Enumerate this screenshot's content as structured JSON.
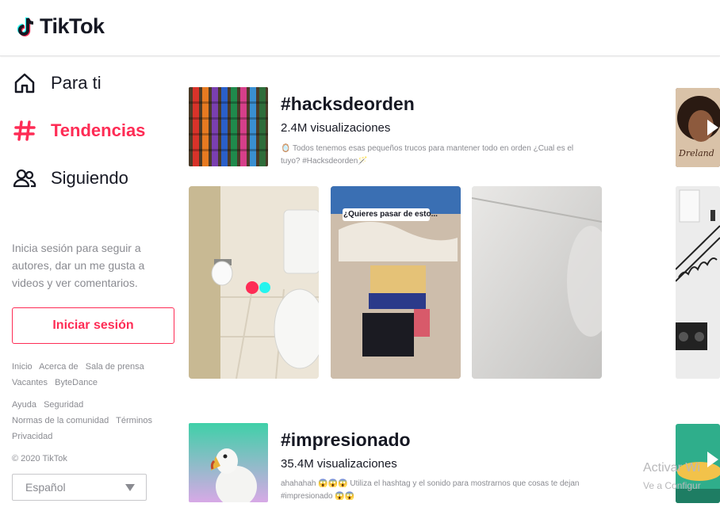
{
  "brand": {
    "name": "TikTok"
  },
  "nav": [
    {
      "label": "Para ti",
      "icon": "home-icon"
    },
    {
      "label": "Tendencias",
      "icon": "hashtag-icon",
      "active": true
    },
    {
      "label": "Siguiendo",
      "icon": "users-icon"
    }
  ],
  "sidebar": {
    "hint": "Inicia sesión para seguir a autores, dar un me gusta a videos y ver comentarios.",
    "login_label": "Iniciar sesión",
    "footer_row1": [
      "Inicio",
      "Acerca de",
      "Sala de prensa"
    ],
    "footer_row2": [
      "Vacantes",
      "ByteDance"
    ],
    "footer_row3": [
      "Ayuda",
      "Seguridad"
    ],
    "footer_row4": [
      "Normas de la comunidad",
      "Términos"
    ],
    "footer_row5": [
      "Privacidad"
    ],
    "copyright": "© 2020 TikTok",
    "language": "Español"
  },
  "trends": [
    {
      "title": "#hacksdeorden",
      "views": "2.4M visualizaciones",
      "description": "🪞 Todos tenemos esas pequeños trucos para mantener todo en orden ¿Cual es el tuyo? #Hacksdeorden🪄",
      "video_caption": "¿Quieres pasar de esto..."
    },
    {
      "title": "#impresionado",
      "views": "35.4M visualizaciones",
      "description": "ahahahah 😱😱😱 Utiliza el hashtag y el sonido para mostrarnos que cosas te dejan #impresionado 😱😱"
    }
  ],
  "watermark": {
    "line1": "Activar Wi",
    "line2": "Ve a Configur"
  },
  "colors": {
    "accent": "#fe2c55",
    "text": "#161823",
    "muted": "#8a8b91"
  }
}
